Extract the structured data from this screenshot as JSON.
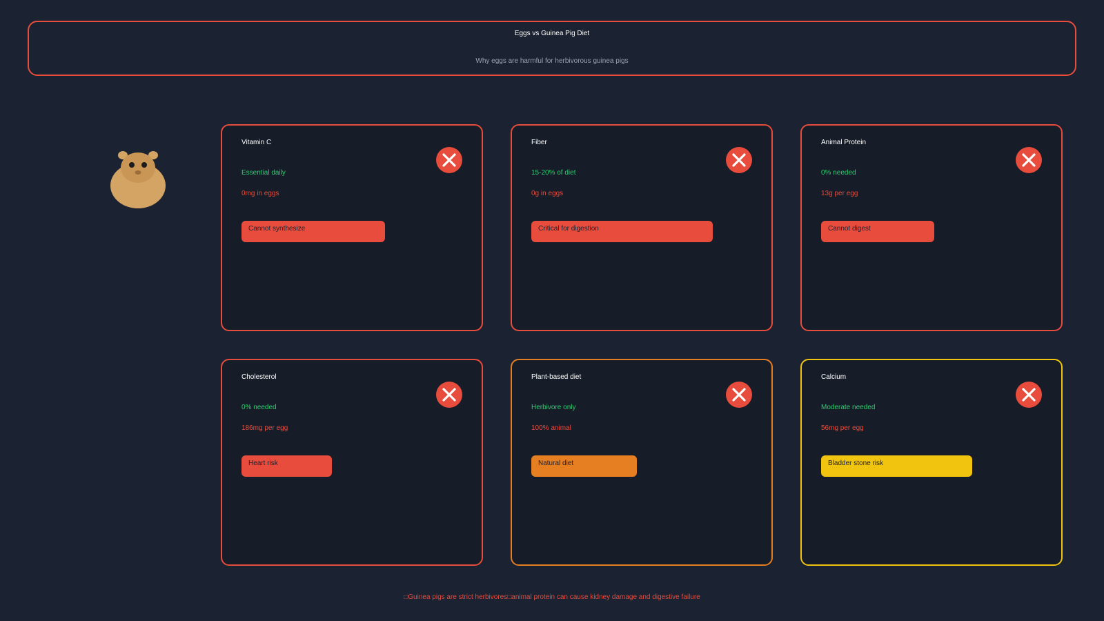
{
  "header": {
    "title": "Eggs vs Guinea Pig Diet",
    "subtitle": "Why eggs are harmful for herbivorous guinea pigs"
  },
  "mascot": {
    "icon": "guinea-pig-icon",
    "color": "#d4a464"
  },
  "colors": {
    "background": "#1b2231",
    "card_background": "#171d28",
    "red": "#e74c3c",
    "orange": "#e67e22",
    "yellow": "#f1c40f",
    "green": "#2ecc71"
  },
  "cards": [
    {
      "title": "Vitamin C",
      "need": "Essential daily",
      "egg": "0mg in eggs",
      "badge": "Cannot synthesize",
      "severity": "red",
      "icon": "x-circle-icon"
    },
    {
      "title": "Fiber",
      "need": "15-20% of diet",
      "egg": "0g in eggs",
      "badge": "Critical for digestion",
      "severity": "red",
      "icon": "x-circle-icon"
    },
    {
      "title": "Animal Protein",
      "need": "0% needed",
      "egg": "13g per egg",
      "badge": "Cannot digest",
      "severity": "red",
      "icon": "x-circle-icon"
    },
    {
      "title": "Cholesterol",
      "need": "0% needed",
      "egg": "186mg per egg",
      "badge": "Heart risk",
      "severity": "red",
      "icon": "x-circle-icon"
    },
    {
      "title": "Plant-based diet",
      "need": "Herbivore only",
      "egg": "100% animal",
      "badge": "Natural diet",
      "severity": "orange",
      "icon": "x-circle-icon"
    },
    {
      "title": "Calcium",
      "need": "Moderate needed",
      "egg": "56mg per egg",
      "badge": "Bladder stone risk",
      "severity": "yellow",
      "icon": "x-circle-icon"
    }
  ],
  "footer": {
    "text": "□Guinea pigs are strict herbivores□animal protein can cause kidney damage and digestive failure"
  }
}
